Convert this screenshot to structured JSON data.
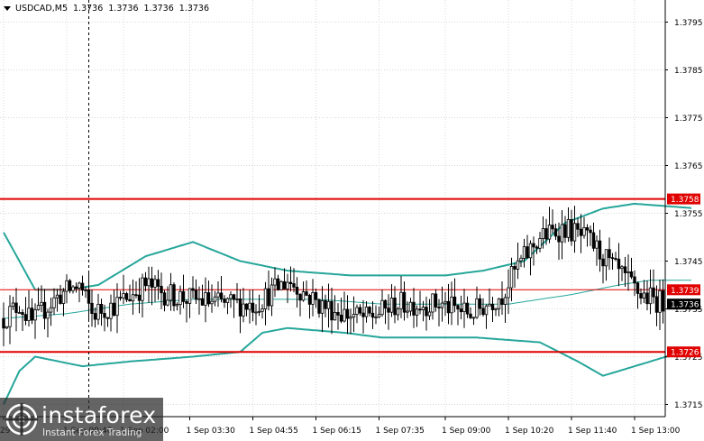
{
  "header": {
    "symbol": "USDCAD,M5",
    "open": "1.3736",
    "high": "1.3736",
    "low": "1.3736",
    "close": "1.3736"
  },
  "colors": {
    "background": "#ffffff",
    "grid": "#d8d8d8",
    "candle": "#000000",
    "band": "#26a69a",
    "level_line": "#e00000",
    "price_tag": "#000000"
  },
  "watermark": {
    "name": "instaforex",
    "tagline": "Instant Forex Trading"
  },
  "chart_data": {
    "type": "candlestick",
    "title": "USDCAD,M5",
    "ylim": [
      1.371,
      1.3799
    ],
    "y_ticks": [
      "1.3795",
      "1.3785",
      "1.3775",
      "1.3765",
      "1.3755",
      "1.3745",
      "1.3735",
      "1.3725",
      "1.3715"
    ],
    "y_tick_values": [
      1.3795,
      1.3785,
      1.3775,
      1.3765,
      1.3755,
      1.3745,
      1.3735,
      1.3725,
      1.3715
    ],
    "x_ticks": [
      "29 ...",
      "1 Sep 00:40",
      "1 Sep 02:00",
      "1 Sep 03:30",
      "1 Sep 04:55",
      "1 Sep 06:15",
      "1 Sep 07:35",
      "1 Sep 09:00",
      "1 Sep 10:20",
      "1 Sep 11:40",
      "1 Sep 13:00"
    ],
    "x_tick_index": [
      0,
      20,
      38,
      59,
      79,
      99,
      119,
      140,
      160,
      180,
      200
    ],
    "n_bars": 210,
    "grid": true,
    "horizontal_levels": [
      {
        "value": 1.3758,
        "label": "1.3758",
        "width": 2
      },
      {
        "value": 1.3739,
        "label": "1.3739",
        "width": 1
      },
      {
        "value": 1.3726,
        "label": "1.3726",
        "width": 2
      }
    ],
    "current_price": {
      "value": 1.3736,
      "label": "1.3736"
    },
    "cursor_bar_index": 27,
    "price_anchors": [
      [
        0,
        1.3733
      ],
      [
        5,
        1.3736
      ],
      [
        9,
        1.3732
      ],
      [
        13,
        1.3735
      ],
      [
        18,
        1.3738
      ],
      [
        24,
        1.374
      ],
      [
        28,
        1.3734
      ],
      [
        36,
        1.3736
      ],
      [
        45,
        1.374
      ],
      [
        52,
        1.3738
      ],
      [
        60,
        1.3737
      ],
      [
        70,
        1.3736
      ],
      [
        80,
        1.3736
      ],
      [
        90,
        1.3741
      ],
      [
        100,
        1.3736
      ],
      [
        108,
        1.3734
      ],
      [
        115,
        1.3733
      ],
      [
        125,
        1.3736
      ],
      [
        138,
        1.3736
      ],
      [
        148,
        1.3734
      ],
      [
        158,
        1.3738
      ],
      [
        163,
        1.3744
      ],
      [
        170,
        1.375
      ],
      [
        178,
        1.3752
      ],
      [
        186,
        1.3749
      ],
      [
        194,
        1.3743
      ],
      [
        202,
        1.3738
      ],
      [
        206,
        1.3737
      ],
      [
        210,
        1.3736
      ]
    ],
    "upper_band": [
      [
        0,
        1.3751
      ],
      [
        10,
        1.3739
      ],
      [
        20,
        1.3739
      ],
      [
        30,
        1.374
      ],
      [
        45,
        1.3746
      ],
      [
        60,
        1.3749
      ],
      [
        75,
        1.3745
      ],
      [
        90,
        1.3743
      ],
      [
        110,
        1.3742
      ],
      [
        140,
        1.3742
      ],
      [
        152,
        1.3743
      ],
      [
        165,
        1.3745
      ],
      [
        178,
        1.3753
      ],
      [
        190,
        1.3756
      ],
      [
        200,
        1.3757
      ],
      [
        220,
        1.3756
      ]
    ],
    "middle_band": [
      [
        0,
        1.3733
      ],
      [
        20,
        1.3734
      ],
      [
        40,
        1.3736
      ],
      [
        60,
        1.3737
      ],
      [
        80,
        1.3737
      ],
      [
        100,
        1.3737
      ],
      [
        120,
        1.3736
      ],
      [
        140,
        1.3736
      ],
      [
        160,
        1.3736
      ],
      [
        180,
        1.3738
      ],
      [
        195,
        1.374
      ],
      [
        205,
        1.3741
      ],
      [
        220,
        1.3741
      ]
    ],
    "lower_band": [
      [
        0,
        1.3715
      ],
      [
        5,
        1.3722
      ],
      [
        10,
        1.3725
      ],
      [
        25,
        1.3723
      ],
      [
        40,
        1.3724
      ],
      [
        60,
        1.3725
      ],
      [
        75,
        1.3726
      ],
      [
        82,
        1.373
      ],
      [
        90,
        1.3731
      ],
      [
        108,
        1.373
      ],
      [
        120,
        1.3729
      ],
      [
        150,
        1.3729
      ],
      [
        170,
        1.3728
      ],
      [
        182,
        1.3724
      ],
      [
        190,
        1.3721
      ],
      [
        200,
        1.3723
      ],
      [
        210,
        1.3725
      ],
      [
        225,
        1.3726
      ]
    ]
  }
}
